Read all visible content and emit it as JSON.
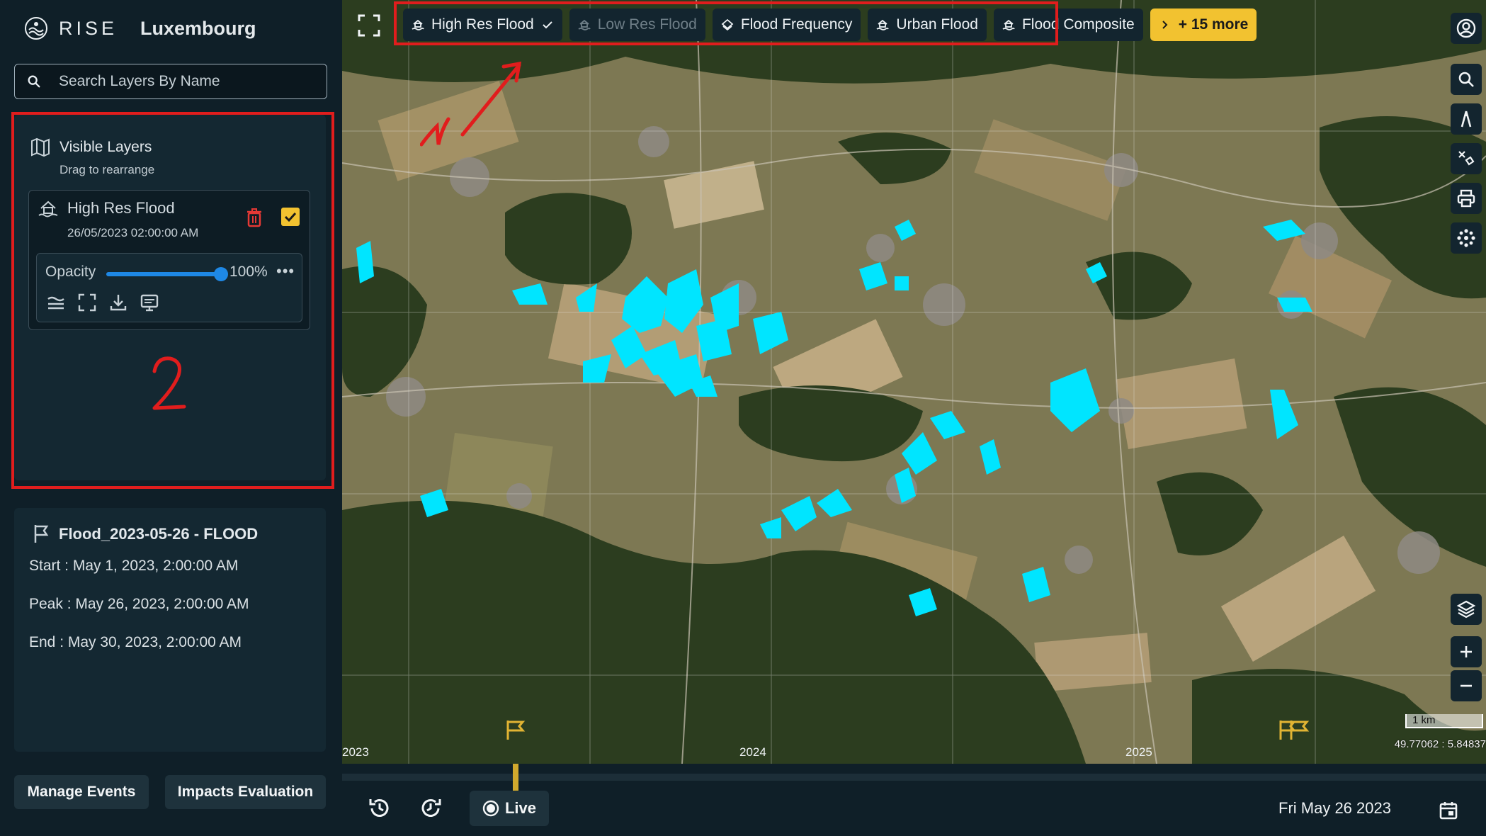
{
  "brand": {
    "name": "RISE",
    "region": "Luxembourg"
  },
  "search": {
    "placeholder": "Search Layers By Name"
  },
  "visible_layers": {
    "title": "Visible Layers",
    "subtitle": "Drag to rearrange",
    "layer": {
      "name": "High Res Flood",
      "date": "26/05/2023 02:00:00 AM",
      "checked": true,
      "opacity_label": "Opacity",
      "opacity_value": "100%",
      "opacity_fraction": 1.0
    }
  },
  "annotations": {
    "panel_number": "2",
    "arrow_number": "1"
  },
  "event": {
    "title": "Flood_2023-05-26 - FLOOD",
    "start": "Start : May 1, 2023, 2:00:00 AM",
    "peak": "Peak : May 26, 2023, 2:00:00 AM",
    "end": "End : May 30, 2023, 2:00:00 AM"
  },
  "buttons": {
    "manage_events": "Manage Events",
    "impacts_evaluation": "Impacts Evaluation"
  },
  "layer_chips": [
    {
      "label": "High Res Flood",
      "state": "active",
      "icon": "flood-icon"
    },
    {
      "label": "Low Res Flood",
      "state": "disabled",
      "icon": "flood-icon"
    },
    {
      "label": "Flood Frequency",
      "state": "normal",
      "icon": "layers-diamond-icon"
    },
    {
      "label": "Urban Flood",
      "state": "normal",
      "icon": "flood-icon"
    },
    {
      "label": "Flood Composite",
      "state": "normal",
      "icon": "flood-icon"
    }
  ],
  "more_chip": {
    "label": "+ 15 more"
  },
  "timeline": {
    "years": [
      "2023",
      "2024",
      "2025"
    ],
    "live_label": "Live",
    "current_date": "Fri May 26 2023"
  },
  "map": {
    "scale": "1 km",
    "coords": "49.77062 : 5.84837"
  },
  "colors": {
    "accent": "#f2c230",
    "flood": "#00e5ff",
    "annotation": "#e11d1d",
    "panel": "#142832",
    "bg": "#0f1f28"
  }
}
